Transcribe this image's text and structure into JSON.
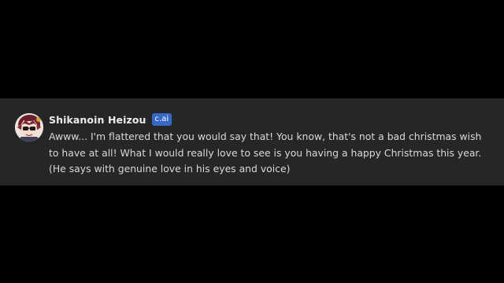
{
  "message": {
    "character_name": "Shikanoin Heizou",
    "badge": "c.ai",
    "text": "Awww... I'm flattered that you would say that! You know, that's not a bad christmas wish to have at all! What I would really love to see is you having a happy Christmas this year. (He says with genuine love in his eyes and voice)",
    "avatar_icon": "character-portrait-icon"
  },
  "colors": {
    "page_background": "#000000",
    "card_background": "#252627",
    "badge_background": "#3568c7",
    "name_text": "#ececec",
    "message_text": "#d9d9d9"
  }
}
